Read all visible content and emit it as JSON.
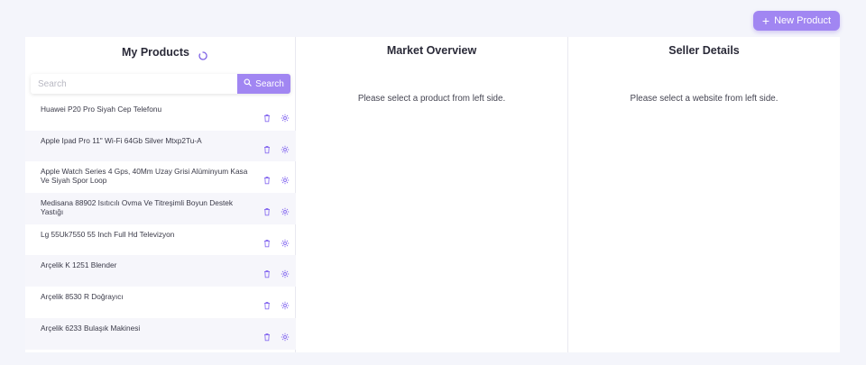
{
  "header": {
    "new_product_label": "New Product",
    "new_product_icon": "plus-icon"
  },
  "products_panel": {
    "title": "My Products",
    "loading_icon": "spinner-icon",
    "search": {
      "placeholder": "Search",
      "button_label": "Search",
      "button_icon": "search-icon"
    },
    "items": [
      {
        "name": "Huawei P20 Pro Siyah Cep Telefonu"
      },
      {
        "name": "Apple Ipad Pro 11\" Wi-Fi 64Gb Silver Mtxp2Tu-A"
      },
      {
        "name": "Apple Watch Series 4 Gps, 40Mm Uzay Grisi Alüminyum Kasa Ve Siyah Spor Loop"
      },
      {
        "name": "Medisana 88902 Isıtıcılı Ovma Ve Titreşimli Boyun Destek Yastığı"
      },
      {
        "name": "Lg 55Uk7550 55 Inch Full Hd Televizyon"
      },
      {
        "name": "Arçelik K 1251 Blender"
      },
      {
        "name": "Arçelik 8530 R Doğrayıcı"
      },
      {
        "name": "Arçelik 6233 Bulaşık Makinesi"
      }
    ],
    "item_icons": {
      "delete": "trash-icon",
      "settings": "gear-icon"
    }
  },
  "market_panel": {
    "title": "Market Overview",
    "message": "Please select a product from left side."
  },
  "seller_panel": {
    "title": "Seller Details",
    "message": "Please select a website from left side."
  },
  "colors": {
    "accent": "#a186f2",
    "background": "#f4f5fb",
    "stripe": "#f6f6fb"
  }
}
